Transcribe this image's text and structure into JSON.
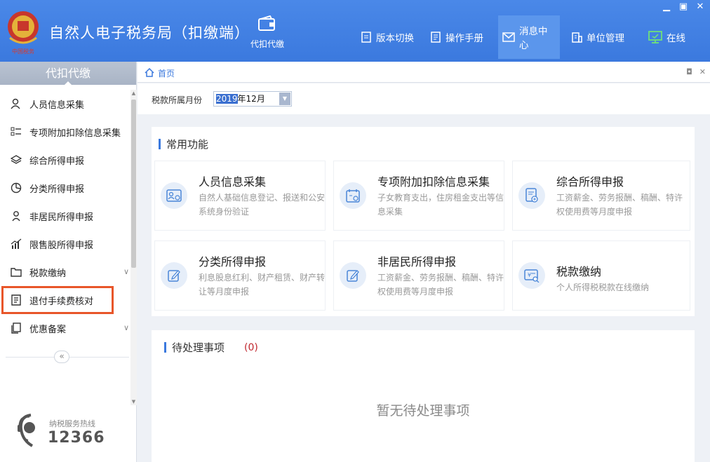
{
  "app": {
    "title": "自然人电子税务局（扣缴端）",
    "emblem_text": "中国税务"
  },
  "header": {
    "center_nav": {
      "label": "代扣代缴",
      "icon": "wallet-icon"
    },
    "menu": [
      {
        "label": "版本切换",
        "icon": "doc-icon"
      },
      {
        "label": "操作手册",
        "icon": "manual-icon"
      },
      {
        "label": "消息中心",
        "icon": "mail-icon",
        "active": true
      },
      {
        "label": "单位管理",
        "icon": "building-icon"
      },
      {
        "label": "在线",
        "icon": "monitor-icon"
      }
    ]
  },
  "sidebar": {
    "heading": "代扣代缴",
    "items": [
      {
        "label": "人员信息采集",
        "icon": "person-icon"
      },
      {
        "label": "专项附加扣除信息采集",
        "icon": "list-icon"
      },
      {
        "label": "综合所得申报",
        "icon": "layers-icon"
      },
      {
        "label": "分类所得申报",
        "icon": "pie-icon"
      },
      {
        "label": "非居民所得申报",
        "icon": "person-outline-icon"
      },
      {
        "label": "限售股所得申报",
        "icon": "bar-chart-icon"
      },
      {
        "label": "税款缴纳",
        "icon": "folder-icon",
        "expandable": true
      },
      {
        "label": "退付手续费核对",
        "icon": "receipt-icon",
        "highlighted": true
      },
      {
        "label": "优惠备案",
        "icon": "copy-icon",
        "expandable": true
      }
    ],
    "collapse_symbol": "«",
    "hotline": {
      "label": "纳税服务热线",
      "number": "12366"
    }
  },
  "tabbar": {
    "home_label": "首页"
  },
  "period": {
    "label": "税款所属月份",
    "value_selected": "2019",
    "value_rest": "年12月"
  },
  "common": {
    "title": "常用功能",
    "cards": [
      {
        "title": "人员信息采集",
        "desc": "自然人基础信息登记、报送和公安系统身份验证",
        "icon": "id-card-icon"
      },
      {
        "title": "专项附加扣除信息采集",
        "desc": "子女教育支出，住房租金支出等信息采集",
        "icon": "calendar-icon"
      },
      {
        "title": "综合所得申报",
        "desc": "工资薪金、劳务报酬、稿酬、特许权使用费等月度申报",
        "icon": "doc-add-icon"
      },
      {
        "title": "分类所得申报",
        "desc": "利息股息红利、财产租赁、财产转让等月度申报",
        "icon": "edit-icon"
      },
      {
        "title": "非居民所得申报",
        "desc": "工资薪金、劳务报酬、稿酬、特许权使用费等月度申报",
        "icon": "edit-icon"
      },
      {
        "title": "税款缴纳",
        "desc": "个人所得税税款在线缴纳",
        "icon": "payment-icon"
      }
    ]
  },
  "pending": {
    "title": "待处理事项",
    "count": "(0)",
    "empty_text": "暂无待处理事项"
  }
}
